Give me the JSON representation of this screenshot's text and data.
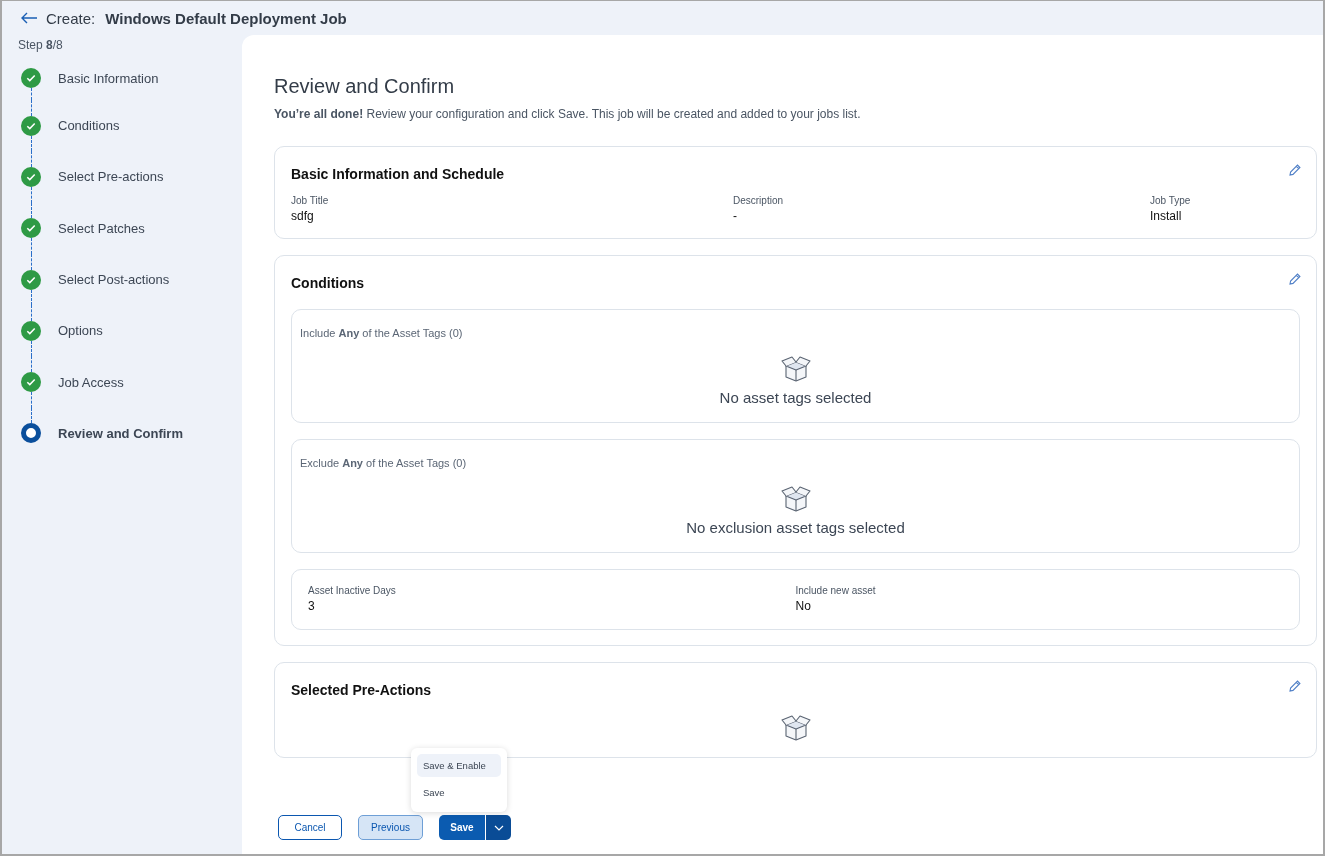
{
  "header": {
    "prefix": "Create:",
    "title": "Windows Default Deployment Job"
  },
  "step_counter": "Step **8**/8",
  "steps": [
    {
      "label": "Basic Information",
      "completed": true,
      "selected": false
    },
    {
      "label": "Conditions",
      "completed": true,
      "selected": false
    },
    {
      "label": "Select Pre-actions",
      "completed": true,
      "selected": false
    },
    {
      "label": "Select Patches",
      "completed": true,
      "selected": false
    },
    {
      "label": "Select Post-actions",
      "completed": true,
      "selected": false
    },
    {
      "label": "Options",
      "completed": true,
      "selected": false
    },
    {
      "label": "Job Access",
      "completed": true,
      "selected": false
    },
    {
      "label": "Review and Confirm",
      "completed": false,
      "selected": true
    }
  ],
  "page": {
    "heading": "Review and Confirm",
    "intro": "**You’re all done!** Review your configuration and click Save. This job will be created and added to your jobs list."
  },
  "sections": [
    {
      "kind": "fields",
      "title": "Basic Information and Schedule",
      "fields": [
        {
          "label": "Job Title",
          "value": "sdfg"
        },
        {
          "label": "Description",
          "value": "-"
        },
        {
          "label": "Job Type",
          "value": "Install"
        }
      ]
    },
    {
      "kind": "conditions",
      "title": "Conditions",
      "tag_groups": [
        {
          "label": "Include **Any** of the Asset Tags (0)",
          "empty": "No asset tags selected"
        },
        {
          "label": "Exclude **Any** of the Asset Tags (0)",
          "empty": "No exclusion asset tags selected"
        }
      ],
      "fields": [
        {
          "label": "Asset Inactive Days",
          "value": "3"
        },
        {
          "label": "Include new asset",
          "value": "No"
        }
      ]
    },
    {
      "kind": "empty",
      "title": "Selected Pre-Actions"
    }
  ],
  "save_menu": [
    {
      "label": "Save & Enable",
      "selected": true
    },
    {
      "label": "Save",
      "selected": false
    }
  ],
  "footer": {
    "cancel": "Cancel",
    "previous": "Previous",
    "save": "Save"
  }
}
